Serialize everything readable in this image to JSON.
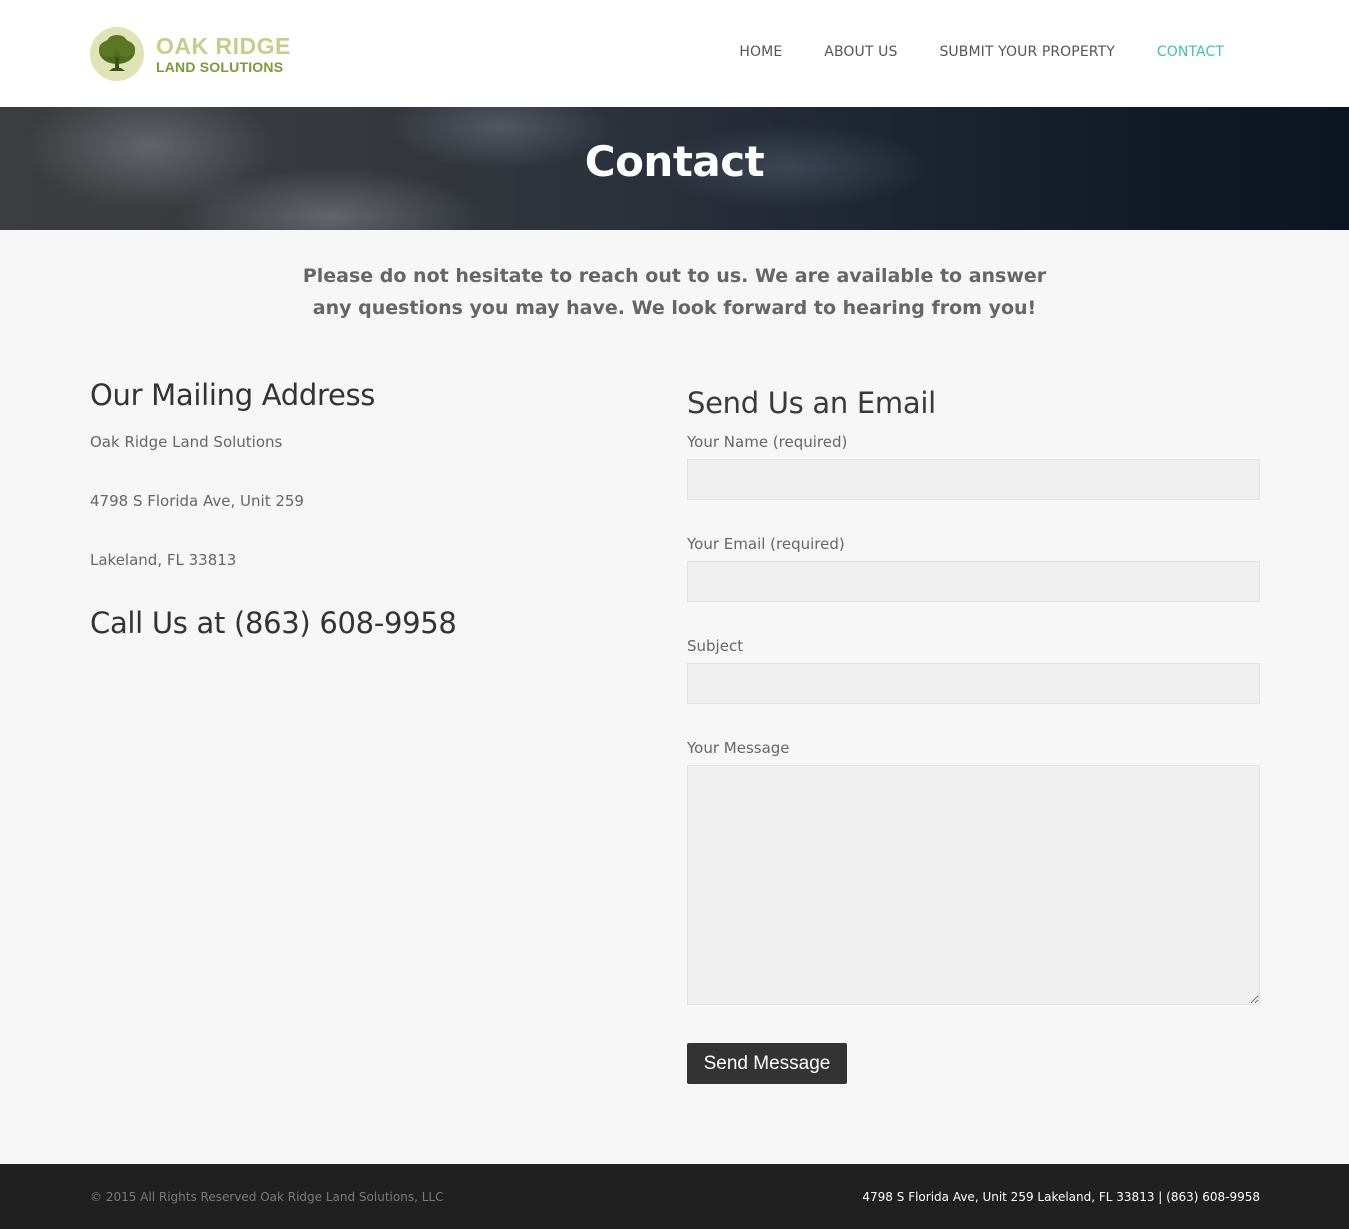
{
  "header": {
    "logo": {
      "icon": "oak-tree-icon",
      "line1": "OAK RIDGE",
      "line2": "LAND SOLUTIONS",
      "circle_color": "#dfe3b6",
      "tree_color": "#4f6b1e"
    },
    "nav": [
      {
        "label": "HOME",
        "active": false
      },
      {
        "label": "ABOUT US",
        "active": false
      },
      {
        "label": "SUBMIT YOUR PROPERTY",
        "active": false
      },
      {
        "label": "CONTACT",
        "active": true
      }
    ],
    "active_color": "#44bfb6"
  },
  "hero": {
    "title": "Contact"
  },
  "intro": {
    "text": "Please do not hesitate to reach out to us. We are available to answer any questions you may have. We look forward to hearing from you!"
  },
  "mailing": {
    "heading": "Our Mailing Address",
    "lines": [
      "Oak Ridge Land Solutions",
      "4798 S Florida Ave, Unit 259",
      "Lakeland, FL 33813"
    ],
    "call_heading": "Call Us at (863) 608-9958"
  },
  "form": {
    "heading": "Send Us an Email",
    "fields": {
      "name": {
        "label": "Your Name (required)",
        "value": ""
      },
      "email": {
        "label": "Your Email (required)",
        "value": ""
      },
      "subject": {
        "label": "Subject",
        "value": ""
      },
      "message": {
        "label": "Your Message",
        "value": ""
      }
    },
    "submit_label": "Send Message"
  },
  "footer": {
    "copyright": "© 2015 All Rights Reserved Oak Ridge Land Solutions, LLC",
    "contact": "4798 S Florida Ave, Unit 259 Lakeland, FL 33813 | (863) 608-9958"
  }
}
